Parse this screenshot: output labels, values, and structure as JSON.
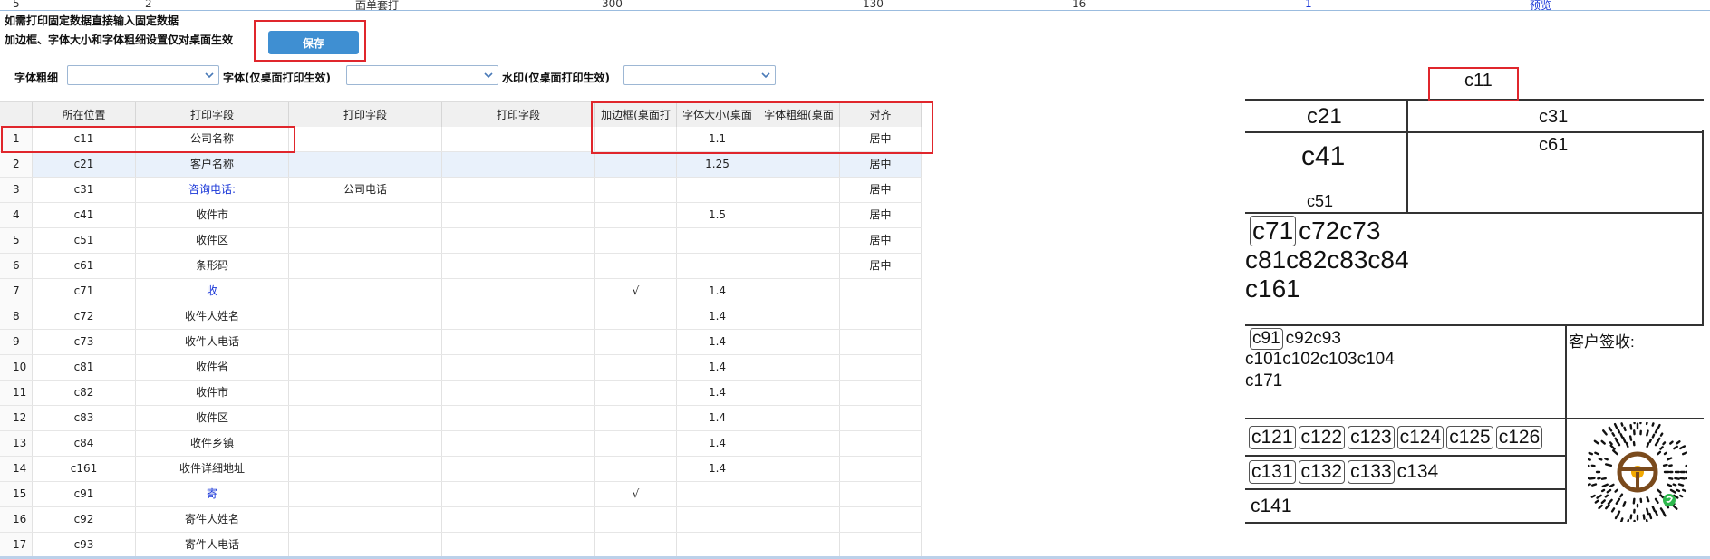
{
  "top_strip": {
    "c0": "5",
    "c1": "2",
    "c2": "面单套打",
    "c3": "300",
    "c4": "130",
    "c5": "16",
    "c6": "1",
    "c7": "预览"
  },
  "notes": {
    "line1": "如需打印固定数据直接输入固定数据",
    "line2": "加边框、字体大小和字体粗细设置仅对桌面生效"
  },
  "toolbar": {
    "save_label": "保存"
  },
  "filters": {
    "weight_label": "字体粗细",
    "font_label": "字体(仅桌面打印生效)",
    "watermark_label": "水印(仅桌面打印生效)",
    "weight_value": "",
    "font_value": "",
    "watermark_value": ""
  },
  "grid": {
    "headers": [
      "",
      "所在位置",
      "打印字段",
      "打印字段",
      "打印字段",
      "加边框(桌面打",
      "字体大小(桌面",
      "字体粗细(桌面",
      "对齐"
    ],
    "rows": [
      {
        "n": "1",
        "pos": "c11",
        "f1": "公司名称",
        "f2": "",
        "f3": "",
        "border": "",
        "size": "1.1",
        "weight": "",
        "align": "居中"
      },
      {
        "n": "2",
        "pos": "c21",
        "f1": "客户名称",
        "f2": "",
        "f3": "",
        "border": "",
        "size": "1.25",
        "weight": "",
        "align": "居中"
      },
      {
        "n": "3",
        "pos": "c31",
        "f1": "咨询电话:",
        "f2": "公司电话",
        "f3": "",
        "border": "",
        "size": "",
        "weight": "",
        "align": "居中"
      },
      {
        "n": "4",
        "pos": "c41",
        "f1": "收件市",
        "f2": "",
        "f3": "",
        "border": "",
        "size": "1.5",
        "weight": "",
        "align": "居中"
      },
      {
        "n": "5",
        "pos": "c51",
        "f1": "收件区",
        "f2": "",
        "f3": "",
        "border": "",
        "size": "",
        "weight": "",
        "align": "居中"
      },
      {
        "n": "6",
        "pos": "c61",
        "f1": "条形码",
        "f2": "",
        "f3": "",
        "border": "",
        "size": "",
        "weight": "",
        "align": "居中"
      },
      {
        "n": "7",
        "pos": "c71",
        "f1": "收",
        "f2": "",
        "f3": "",
        "border": "√",
        "size": "1.4",
        "weight": "",
        "align": ""
      },
      {
        "n": "8",
        "pos": "c72",
        "f1": "收件人姓名",
        "f2": "",
        "f3": "",
        "border": "",
        "size": "1.4",
        "weight": "",
        "align": ""
      },
      {
        "n": "9",
        "pos": "c73",
        "f1": "收件人电话",
        "f2": "",
        "f3": "",
        "border": "",
        "size": "1.4",
        "weight": "",
        "align": ""
      },
      {
        "n": "10",
        "pos": "c81",
        "f1": "收件省",
        "f2": "",
        "f3": "",
        "border": "",
        "size": "1.4",
        "weight": "",
        "align": ""
      },
      {
        "n": "11",
        "pos": "c82",
        "f1": "收件市",
        "f2": "",
        "f3": "",
        "border": "",
        "size": "1.4",
        "weight": "",
        "align": ""
      },
      {
        "n": "12",
        "pos": "c83",
        "f1": "收件区",
        "f2": "",
        "f3": "",
        "border": "",
        "size": "1.4",
        "weight": "",
        "align": ""
      },
      {
        "n": "13",
        "pos": "c84",
        "f1": "收件乡镇",
        "f2": "",
        "f3": "",
        "border": "",
        "size": "1.4",
        "weight": "",
        "align": ""
      },
      {
        "n": "14",
        "pos": "c161",
        "f1": "收件详细地址",
        "f2": "",
        "f3": "",
        "border": "",
        "size": "1.4",
        "weight": "",
        "align": ""
      },
      {
        "n": "15",
        "pos": "c91",
        "f1": "寄",
        "f2": "",
        "f3": "",
        "border": "√",
        "size": "",
        "weight": "",
        "align": ""
      },
      {
        "n": "16",
        "pos": "c92",
        "f1": "寄件人姓名",
        "f2": "",
        "f3": "",
        "border": "",
        "size": "",
        "weight": "",
        "align": ""
      },
      {
        "n": "17",
        "pos": "c93",
        "f1": "寄件人电话",
        "f2": "",
        "f3": "",
        "border": "",
        "size": "",
        "weight": "",
        "align": ""
      }
    ]
  },
  "preview": {
    "c11": "c11",
    "c21": "c21",
    "c31": "c31",
    "c41": "c41",
    "c51": "c51",
    "c61": "c61",
    "c71": "c71",
    "c72c73": "c72c73",
    "line_c8": "c81c82c83c84",
    "c161": "c161",
    "c91": "c91",
    "c92c93": "c92c93",
    "line_c10": "c101c102c103c104",
    "c171": "c171",
    "sign": "客户签收:",
    "c121": "c121",
    "c122": "c122",
    "c123": "c123",
    "c124": "c124",
    "c125": "c125",
    "c126": "c126",
    "c131": "c131",
    "c132": "c132",
    "c133": "c133",
    "c134": "c134",
    "c141": "c141"
  },
  "colors": {
    "accent": "#3f8fd2",
    "highlight": "#e0262c",
    "link": "#1a37d8"
  }
}
